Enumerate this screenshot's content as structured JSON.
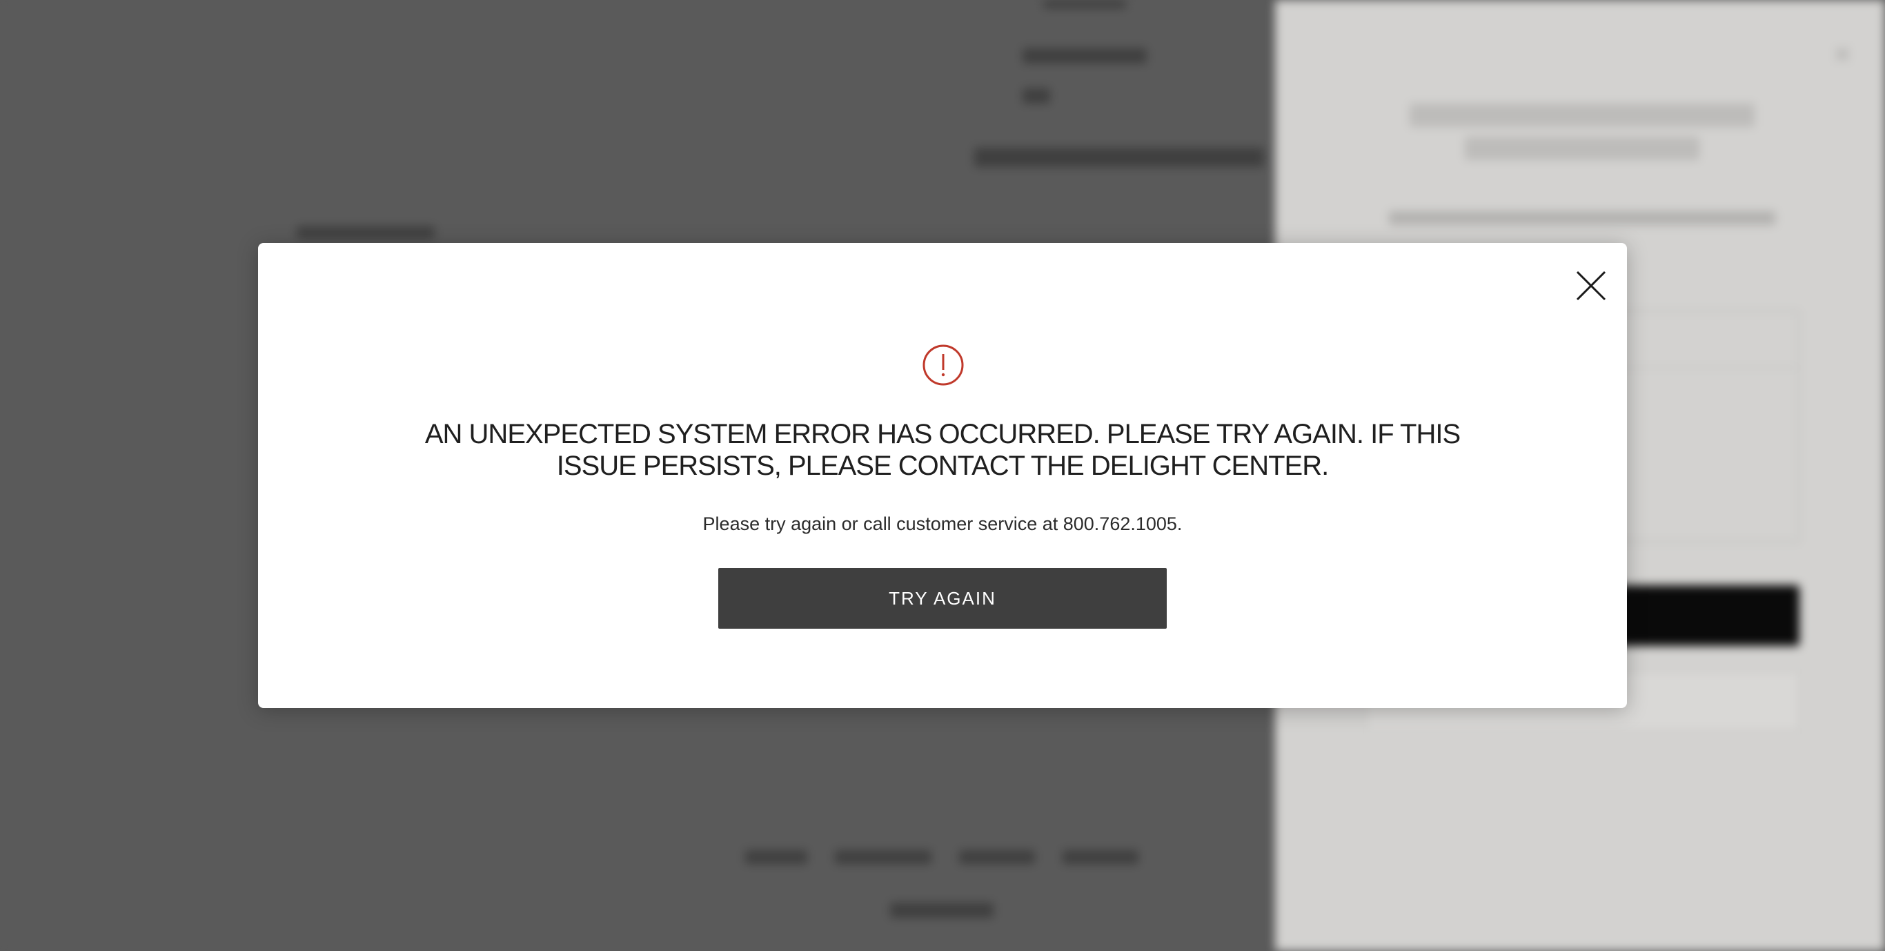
{
  "modal": {
    "title": "AN UNEXPECTED SYSTEM ERROR HAS OCCURRED. PLEASE TRY AGAIN. IF THIS ISSUE PERSISTS, PLEASE CONTACT THE DELIGHT CENTER.",
    "message": "Please try again or call customer service at 800.762.1005.",
    "try_again_label": "TRY AGAIN",
    "close_icon": "close-icon",
    "alert_icon": "alert-circle-icon",
    "alert_color": "#c0392b"
  },
  "colors": {
    "overlay": "#5a5a5a",
    "modal_bg": "#ffffff",
    "button_bg": "#3f3f3f",
    "side_panel_bg": "#d3d2d0"
  }
}
